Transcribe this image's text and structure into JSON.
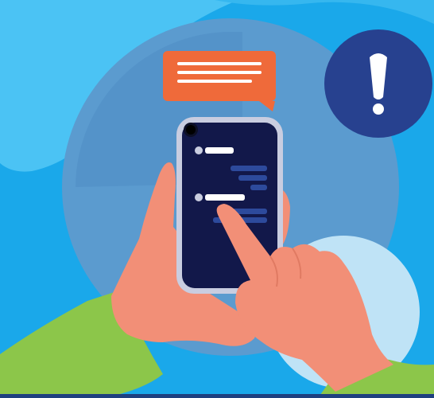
{
  "illustration": {
    "alert_icon": "exclamation-icon",
    "speech_bubble_icon": "speech-bubble-icon",
    "colors": {
      "sky": "#4bc3f4",
      "circle": "#5b9bcf",
      "circle_dark": "#4f8cc4",
      "circle_light": "#bfe3f6",
      "alert_circle": "#27418f",
      "bubble": "#ef6a3a",
      "phone_frame": "#c9cde0",
      "phone_screen": "#12184a",
      "chat_dark": "#2d4a9c",
      "skin": "#f28f77",
      "sleeve": "#8cc64a",
      "bottom_bar": "#1e4080"
    }
  }
}
